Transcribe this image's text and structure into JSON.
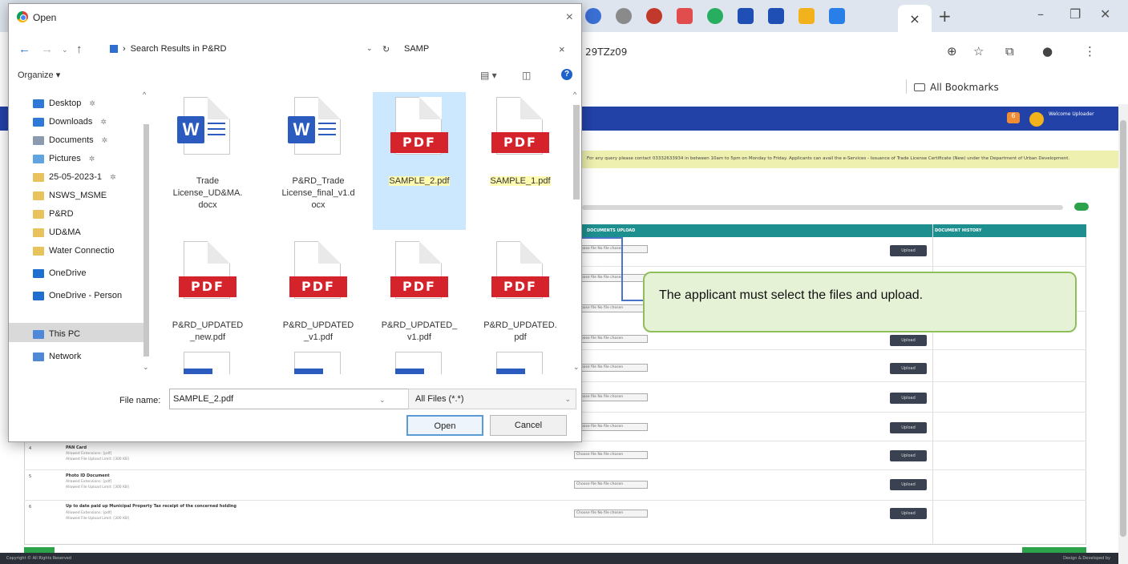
{
  "browser": {
    "url_fragment": "29TZz09",
    "bookmarks_label": "All Bookmarks",
    "active_tab_close": "×",
    "new_tab": "+"
  },
  "app": {
    "notification_count": "6",
    "welcome_text": "Welcome Uploader",
    "notice_text": "For any query please contact 03332633934 in between 10am to 5pm on Monday to Friday. Applicants can avail the e-Services - Issuance of Trade License Certificate (New) under the Department of Urban Development.",
    "table_headers": {
      "document_upload": "DOCUMENTS UPLOAD",
      "document_history": "DOCUMENT HISTORY"
    },
    "choose_file_text": "Choose file  No file chosen",
    "upload_label": "Upload",
    "rows": [
      {
        "num": "4",
        "title": "PAN Card",
        "sub1": "Allowed Extensions: [pdf]",
        "sub2": "Allowed File Upload Limit: [300 KB]"
      },
      {
        "num": "5",
        "title": "Photo ID Document",
        "sub1": "Allowed Extensions: [pdf]",
        "sub2": "Allowed File Upload Limit: [300 KB]"
      },
      {
        "num": "6",
        "title": "Up to date paid up Municipal Property Tax receipt of the concerned holding",
        "sub1": "Allowed Extensions: [pdf]",
        "sub2": "Allowed File Upload Limit: [300 KB]"
      }
    ],
    "footer_left": "Copyright © All Rights Reserved",
    "footer_right": "Design & Developed by"
  },
  "callout": {
    "text": "The applicant must select the files and upload."
  },
  "dialog": {
    "title": "Open",
    "close": "×",
    "breadcrumb": "Search Results in P&RD",
    "search_value": "SAMP",
    "search_clear": "×",
    "organize": "Organize ▾",
    "help": "?",
    "nav_items": [
      {
        "label": "Desktop",
        "pinned": true,
        "color": "#2e78d8"
      },
      {
        "label": "Downloads",
        "pinned": true,
        "color": "#2e78d8"
      },
      {
        "label": "Documents",
        "pinned": true,
        "color": "#8a9bb0"
      },
      {
        "label": "Pictures",
        "pinned": true,
        "color": "#5fa3e0"
      },
      {
        "label": "25-05-2023-1",
        "pinned": true,
        "color": "#e8c25a"
      },
      {
        "label": "NSWS_MSME",
        "pinned": false,
        "color": "#e8c25a"
      },
      {
        "label": "P&RD",
        "pinned": false,
        "color": "#e8c25a"
      },
      {
        "label": "UD&MA",
        "pinned": false,
        "color": "#e8c25a"
      },
      {
        "label": "Water Connectio",
        "pinned": false,
        "color": "#e8c25a"
      },
      {
        "label": "OneDrive",
        "pinned": false,
        "color": "#1f6fd0"
      },
      {
        "label": "OneDrive - Person",
        "pinned": false,
        "color": "#1f6fd0"
      },
      {
        "label": "This PC",
        "pinned": false,
        "color": "#4f88d6"
      },
      {
        "label": "Network",
        "pinned": false,
        "color": "#4f88d6"
      }
    ],
    "files": [
      {
        "type": "word",
        "line1": "Trade",
        "line2": "License_UD&MA.",
        "line3": "docx",
        "selected": false,
        "highlight": false
      },
      {
        "type": "word",
        "line1": "P&RD_Trade",
        "line2": "License_final_v1.d",
        "line3": "ocx",
        "selected": false,
        "highlight": false
      },
      {
        "type": "pdf",
        "line1": "SAMPLE_2.pdf",
        "line2": "",
        "line3": "",
        "selected": true,
        "highlight": true
      },
      {
        "type": "pdf",
        "line1": "SAMPLE_1.pdf",
        "line2": "",
        "line3": "",
        "selected": false,
        "highlight": true
      },
      {
        "type": "pdf",
        "line1": "P&RD_UPDATED",
        "line2": "_new.pdf",
        "line3": "",
        "selected": false,
        "highlight": false
      },
      {
        "type": "pdf",
        "line1": "P&RD_UPDATED",
        "line2": "_v1.pdf",
        "line3": "",
        "selected": false,
        "highlight": false
      },
      {
        "type": "pdf",
        "line1": "P&RD_UPDATED_",
        "line2": "v1.pdf",
        "line3": "",
        "selected": false,
        "highlight": false
      },
      {
        "type": "pdf",
        "line1": "P&RD_UPDATED.",
        "line2": "pdf",
        "line3": "",
        "selected": false,
        "highlight": false
      }
    ],
    "pdf_badge": "PDF",
    "word_badge": "W",
    "file_name_label": "File name:",
    "file_name_value": "SAMPLE_2.pdf",
    "filter_value": "All Files (*.*)",
    "open_label": "Open",
    "cancel_label": "Cancel"
  }
}
